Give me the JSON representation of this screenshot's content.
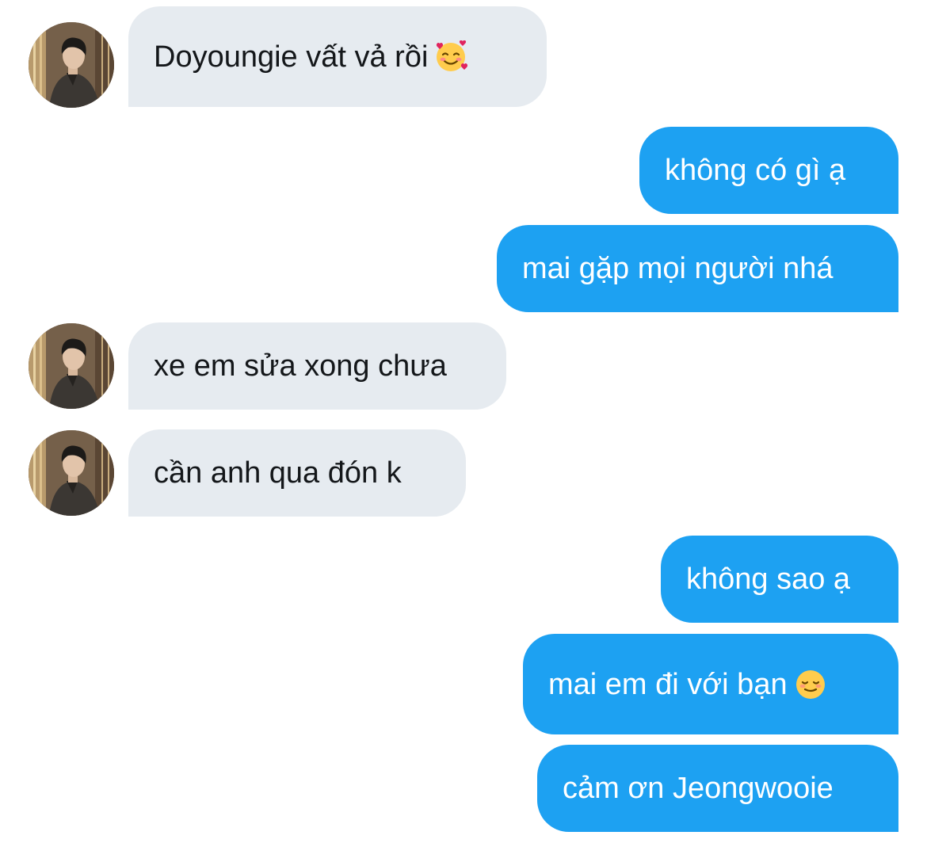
{
  "conversation": {
    "messages": [
      {
        "side": "in",
        "text": "Doyoungie vất vả rồi",
        "emoji": "smiling-face-with-hearts-icon"
      },
      {
        "side": "out",
        "text": "không có gì ạ"
      },
      {
        "side": "out",
        "text": "mai gặp mọi người nhá"
      },
      {
        "side": "in",
        "text": "xe em sửa xong chưa"
      },
      {
        "side": "in",
        "text": "cần anh qua đón k"
      },
      {
        "side": "out",
        "text": "không sao ạ"
      },
      {
        "side": "out",
        "text": "mai em đi với bạn",
        "emoji": "smiling-face-icon"
      },
      {
        "side": "out",
        "text": "cảm ơn Jeongwooie"
      }
    ]
  },
  "colors": {
    "incoming_bubble": "#e6ebf0",
    "outgoing_bubble": "#1da1f2",
    "incoming_text": "#14171a",
    "outgoing_text": "#ffffff"
  }
}
